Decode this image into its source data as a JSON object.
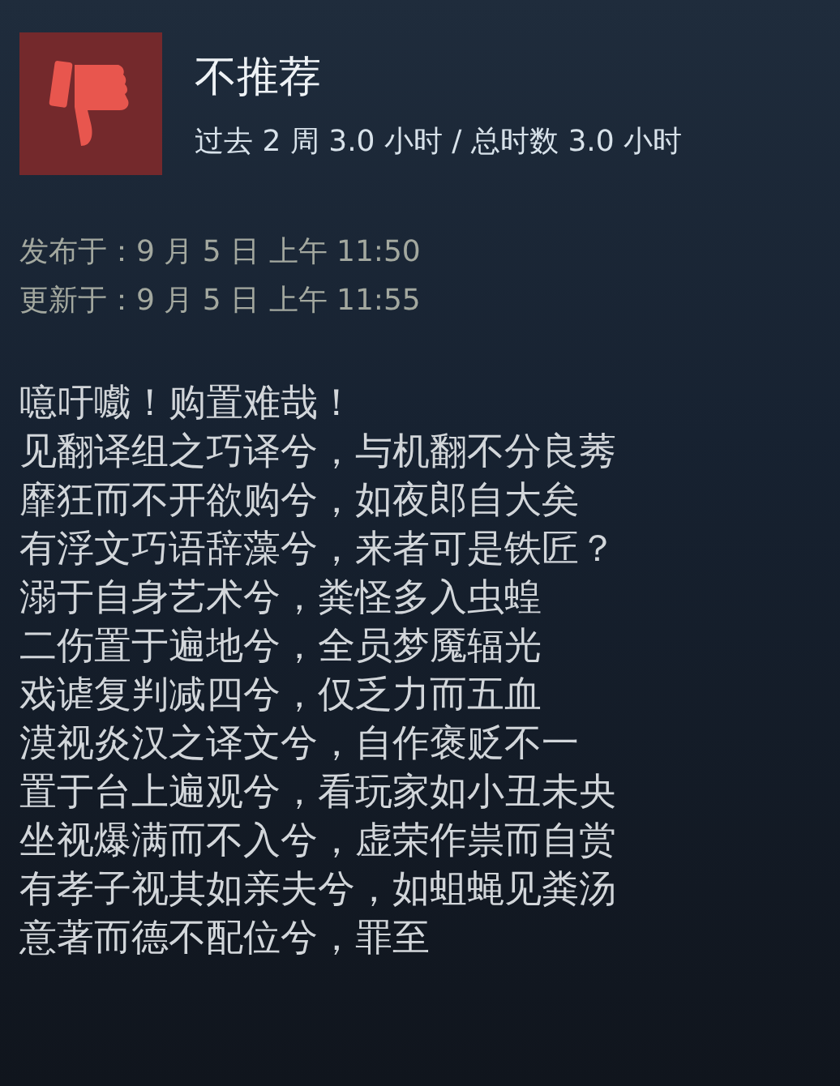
{
  "review": {
    "verdict": {
      "kind": "not_recommended",
      "label": "不推荐"
    },
    "playtime": "过去 2 周 3.0 小时 / 总时数 3.0 小时",
    "dates": [
      "发布于：9 月 5 日 上午 11:50",
      "更新于：9 月 5 日 上午 11:55"
    ],
    "body": [
      "噫吁嚱！购置难哉！",
      "见翻译组之巧译兮，与机翻不分良莠",
      "靡狂而不开欲购兮，如夜郎自大矣",
      "有浮文巧语辞藻兮，来者可是铁匠？",
      "溺于自身艺术兮，粪怪多入虫蝗",
      "二伤置于遍地兮，全员梦魇辐光",
      "戏谑复判减四兮，仅乏力而五血",
      "漠视炎汉之译文兮，自作褒贬不一",
      "置于台上遍观兮，看玩家如小丑未央",
      "坐视爆满而不入兮，虚荣作祟而自赏",
      "有孝子视其如亲夫兮，如蛆蝇见粪汤",
      "意著而德不配位兮，罪至"
    ]
  }
}
